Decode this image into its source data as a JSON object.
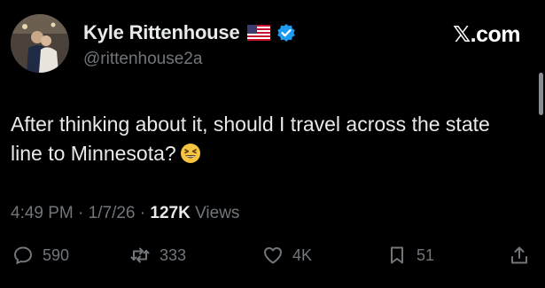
{
  "user": {
    "display_name": "Kyle Rittenhouse",
    "handle": "@rittenhouse2a",
    "flag_icon": "us-flag-icon",
    "verified_icon": "verified-badge-icon",
    "avatar": "profile-photo"
  },
  "brand": {
    "logo_x": "𝕏",
    "logo_suffix": ".com"
  },
  "tweet": {
    "text": "After thinking about it, should I travel across the state line to Minnesota?",
    "emoji": "grinning-squinting-face"
  },
  "meta": {
    "time": "4:49 PM",
    "separator": " · ",
    "date": "1/7/26",
    "views_count": "127K",
    "views_label": " Views"
  },
  "actions": {
    "replies": "590",
    "reposts": "333",
    "likes": "4K",
    "bookmarks": "51"
  },
  "colors": {
    "background": "#000000",
    "text": "#e7e9ea",
    "secondary": "#71767b",
    "verified": "#1d9bf0",
    "emoji": "#f5c542"
  }
}
